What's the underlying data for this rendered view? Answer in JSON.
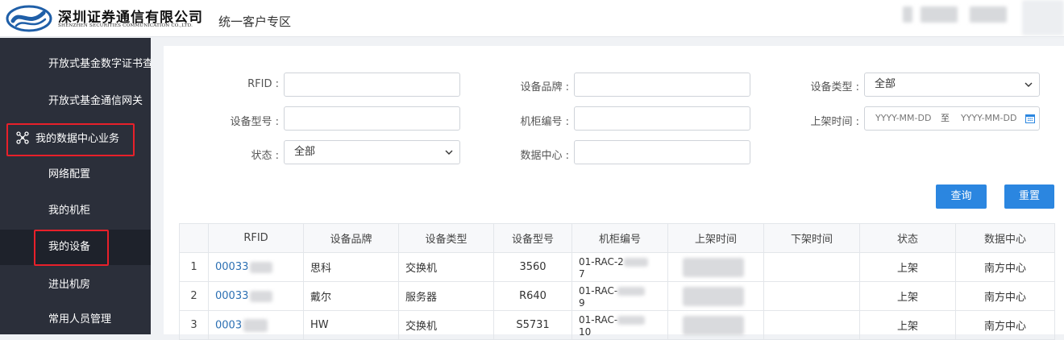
{
  "header": {
    "company_name": "深圳证券通信有限公司",
    "company_name_en": "SHENZHEN SECURITIES COMMUNICATION CO.,LTD.",
    "portal_title": "统一客户专区",
    "brand_color": "#1f5fa8"
  },
  "sidebar": {
    "items": [
      {
        "label": "开放式基金数字证书查询"
      },
      {
        "label": "开放式基金通信网关"
      },
      {
        "label": "我的数据中心业务",
        "icon": "network-icon"
      },
      {
        "label": "网络配置"
      },
      {
        "label": "我的机柜"
      },
      {
        "label": "我的设备"
      },
      {
        "label": "进出机房"
      },
      {
        "label": "常用人员管理"
      }
    ],
    "highlight_color": "#e8202a"
  },
  "filters": {
    "rfid_label": "RFID :",
    "rfid_value": "",
    "brand_label": "设备品牌 :",
    "brand_value": "",
    "type_label": "设备类型 :",
    "type_value": "全部",
    "model_label": "设备型号 :",
    "model_value": "",
    "cabinet_label": "机柜编号 :",
    "cabinet_value": "",
    "shelf_time_label": "上架时间 :",
    "date_from_placeholder": "YYYY-MM-DD",
    "date_sep": "至",
    "date_to_placeholder": "YYYY-MM-DD",
    "status_label": "状态 :",
    "status_value": "全部",
    "datacenter_label": "数据中心 :",
    "datacenter_value": ""
  },
  "actions": {
    "query_label": "查询",
    "reset_label": "重置",
    "button_color": "#2b86e0"
  },
  "table": {
    "columns": [
      "RFID",
      "设备品牌",
      "设备类型",
      "设备型号",
      "机柜编号",
      "上架时间",
      "下架时间",
      "状态",
      "数据中心"
    ],
    "rows": [
      {
        "index": "1",
        "rfid": "00033",
        "brand": "思科",
        "type": "交换机",
        "model": "3560",
        "cabinet_a": "01-RAC-2",
        "cabinet_b": "7",
        "shelf_time": "",
        "unshelf_time": "",
        "status": "上架",
        "datacenter": "南方中心"
      },
      {
        "index": "2",
        "rfid": "00033",
        "brand": "戴尔",
        "type": "服务器",
        "model": "R640",
        "cabinet_a": "01-RAC-",
        "cabinet_b": "9",
        "shelf_time": "",
        "unshelf_time": "",
        "status": "上架",
        "datacenter": "南方中心"
      },
      {
        "index": "3",
        "rfid": "0003",
        "brand": "HW",
        "type": "交换机",
        "model": "S5731",
        "cabinet_a": "01-RAC-",
        "cabinet_b": "10",
        "shelf_time": "",
        "unshelf_time": "",
        "status": "上架",
        "datacenter": "南方中心"
      }
    ]
  }
}
